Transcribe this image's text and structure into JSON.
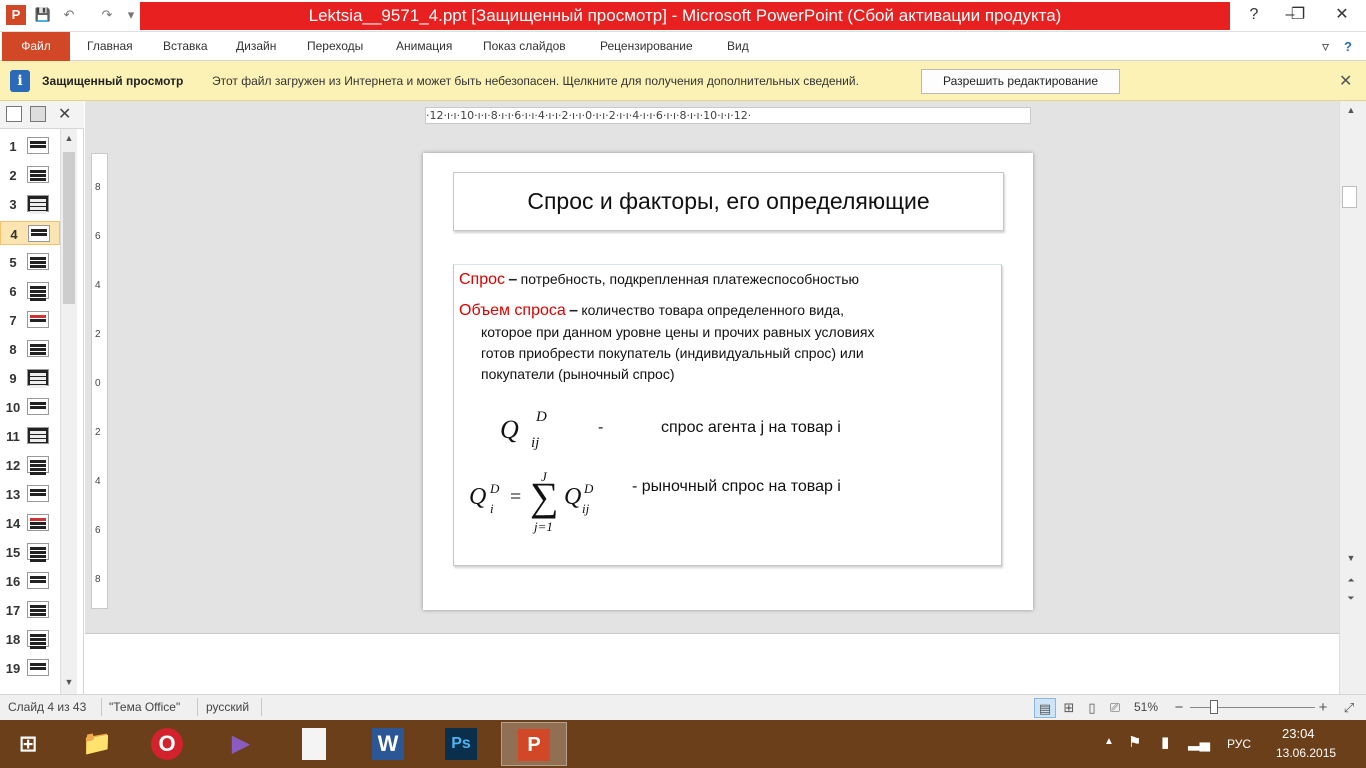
{
  "window": {
    "title": "Lektsia__9571_4.ppt [Защищенный просмотр]  -  Microsoft PowerPoint (Сбой активации продукта)",
    "app_icon": "P",
    "controls": {
      "minimize": "–",
      "maximize": "❐",
      "close": "✕"
    },
    "quick_access": {
      "save": "💾",
      "undo": "↶",
      "redo": "↷",
      "customize": "▾"
    }
  },
  "ribbon": {
    "file_tab": "Файл",
    "tabs": [
      "Главная",
      "Вставка",
      "Дизайн",
      "Переходы",
      "Анимация",
      "Показ слайдов",
      "Рецензирование",
      "Вид"
    ],
    "minimize_icon": "▿",
    "help_icon": "?"
  },
  "protected_view": {
    "title": "Защищенный просмотр",
    "message": "Этот файл загружен из Интернета и может быть небезопасен. Щелкните для получения дополнительных сведений.",
    "button": "Разрешить редактирование",
    "info_icon": "i",
    "close_icon": "✕"
  },
  "thumbnails": {
    "selected": 4,
    "items": [
      "1",
      "2",
      "3",
      "4",
      "5",
      "6",
      "7",
      "8",
      "9",
      "10",
      "11",
      "12",
      "13",
      "14",
      "15",
      "16",
      "17",
      "18",
      "19"
    ],
    "close_icon": "✕"
  },
  "ruler": {
    "horizontal": "·12·ı·ı·10·ı·ı·8·ı·ı·6·ı·ı·4·ı·ı·2·ı·ı·0·ı·ı·2·ı·ı·4·ı·ı·6·ı·ı·8·ı·ı·10·ı·ı·12·",
    "vertical": [
      "8",
      "6",
      "4",
      "2",
      "0",
      "2",
      "4",
      "6",
      "8"
    ]
  },
  "slide": {
    "title": "Спрос и факторы, его определяющие",
    "term1": "Спрос",
    "dash": "–",
    "def1": "потребность, подкрепленная  платежеспособностью",
    "term2": "Объем спроса",
    "def2_line1": "количество товара определенного  вида,",
    "def2_line2": "которое при данном уровне цены и прочих  равных  условиях",
    "def2_line3": "готов приобрести  покупатель (индивидуальный спрос) или",
    "def2_line4": "покупатели (рыночный спрос)",
    "f1_desc_dash": "-",
    "f1_desc": "спрос  агента j на товар i",
    "f2_desc": "-   рыночный  спрос на товар i",
    "f1": {
      "base": "Q",
      "sup": "D",
      "sub": "ij"
    },
    "f2": {
      "lhs": "Q",
      "lhs_sup": "D",
      "lhs_sub": "i",
      "eq": "=",
      "sum": "∑",
      "sum_top": "J",
      "sum_bottom": "j=1",
      "rhs": "Q",
      "rhs_sup": "D",
      "rhs_sub": "ij"
    }
  },
  "statusbar": {
    "slide_info": "Слайд 4 из 43",
    "theme": "\"Тема Office\"",
    "language": "русский",
    "zoom": "51%",
    "zoom_minus": "−",
    "zoom_plus": "+",
    "zoom_fraction": 0.19
  },
  "taskbar": {
    "apps": [
      {
        "name": "explorer",
        "glyph": "📁"
      },
      {
        "name": "opera",
        "glyph": "O"
      },
      {
        "name": "visual-studio",
        "glyph": "▶"
      },
      {
        "name": "document",
        "glyph": ""
      },
      {
        "name": "word",
        "glyph": "W"
      },
      {
        "name": "photoshop",
        "glyph": "Ps"
      },
      {
        "name": "powerpoint",
        "glyph": "P"
      }
    ],
    "language": "РУС",
    "time": "23:04",
    "date": "13.06.2015"
  },
  "colors": {
    "accent": "#d24726",
    "title_bar": "#e82020",
    "protected_bar": "#fcf2b5",
    "term_red": "#e00000",
    "taskbar": "#6b3f1a"
  }
}
